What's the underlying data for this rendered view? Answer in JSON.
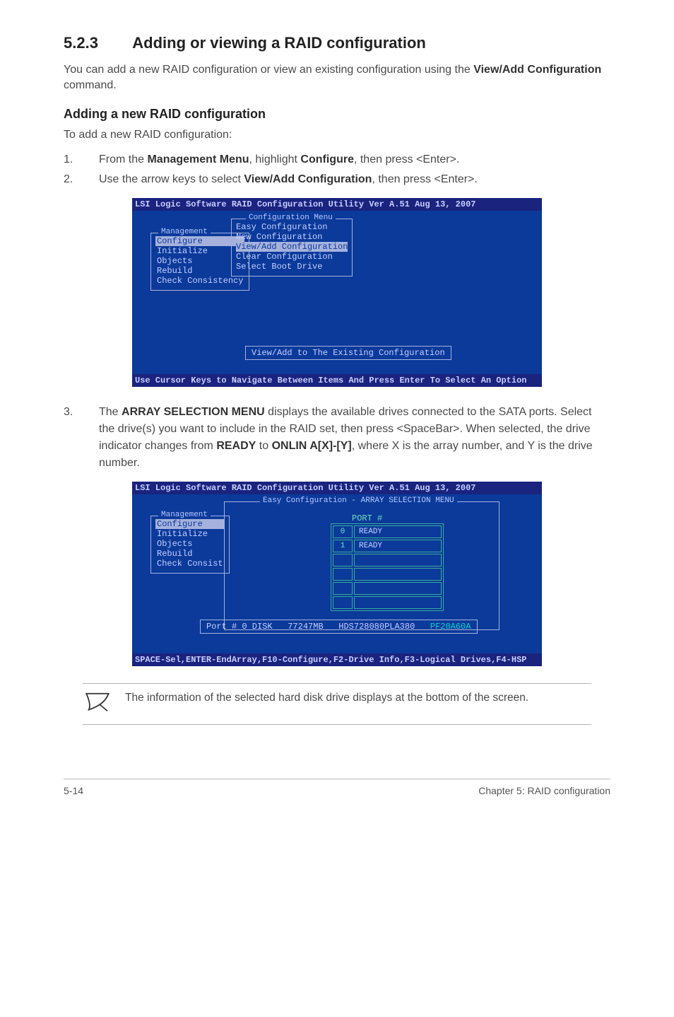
{
  "section": {
    "number": "5.2.3",
    "title": "Adding or viewing a RAID configuration"
  },
  "intro": {
    "pre": "You can add a new RAID configuration or view an existing configuration using the ",
    "bold": "View/Add Configuration",
    "post": " command."
  },
  "subhead": "Adding a new RAID configuration",
  "subintro": "To add a new RAID configuration:",
  "step1": {
    "pre": "From the ",
    "b1": "Management Menu",
    "mid": ", highlight ",
    "b2": "Configure",
    "post": ", then press <Enter>."
  },
  "step2": {
    "pre": "Use the arrow keys to select ",
    "b1": "View/Add Configuration",
    "post": ", then press <Enter>."
  },
  "bios1": {
    "title": "LSI Logic Software RAID Configuration Utility Ver A.51 Aug 13, 2007",
    "mgmt_legend": "Management",
    "mgmt_items": [
      "Configure",
      "Initialize",
      "Objects",
      "Rebuild",
      "Check Consistency"
    ],
    "cfg_legend": "Configuration Menu",
    "cfg_items": [
      "Easy Configuration",
      "New Configuration",
      "View/Add Configuration",
      "Clear Configuration",
      "Select Boot Drive"
    ],
    "status": "View/Add to The Existing Configuration",
    "footer": "Use Cursor Keys to Navigate Between Items And Press Enter To Select An Option"
  },
  "step3": {
    "pre": "The ",
    "b1": "ARRAY SELECTION MENU",
    "mid1": " displays the available drives connected to the SATA ports. Select the drive(s) you want to include in the RAID set, then press <SpaceBar>. When selected, the drive indicator changes from ",
    "b2": "READY",
    "mid2": " to ",
    "b3": "ONLIN A[X]-[Y]",
    "post": ", where X is the array number, and Y is the drive number."
  },
  "bios2": {
    "title": "LSI Logic Software RAID Configuration Utility Ver A.51 Aug 13, 2007",
    "arraysel_legend": "Easy Configuration - ARRAY SELECTION MENU",
    "mgmt_legend": "Management",
    "mgmt_items": [
      "Configure",
      "Initialize",
      "Objects",
      "Rebuild",
      "Check Consist"
    ],
    "port_hdr": "PORT #",
    "rows": [
      {
        "idx": "0",
        "state": "READY"
      },
      {
        "idx": "1",
        "state": "READY"
      }
    ],
    "diskinfo": {
      "label": "Port # 0 DISK",
      "size": "77247MB",
      "model": "HDS728080PLA380",
      "fw": "PF20A60A"
    },
    "footer": "SPACE-Sel,ENTER-EndArray,F10-Configure,F2-Drive Info,F3-Logical Drives,F4-HSP"
  },
  "note": "The information of the selected hard disk drive displays at the bottom of the screen.",
  "pagefooter": {
    "left": "5-14",
    "right": "Chapter 5: RAID configuration"
  }
}
